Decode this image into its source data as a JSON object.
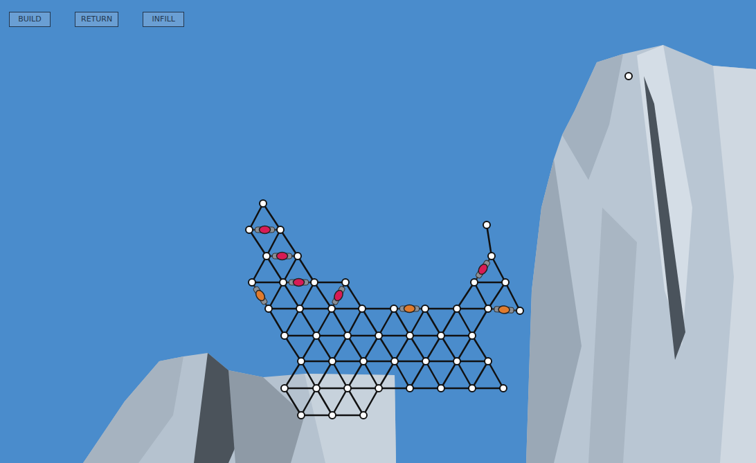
{
  "buttons": [
    {
      "label": "BUILD"
    },
    {
      "label": "RETURN"
    },
    {
      "label": "INFILL"
    }
  ],
  "pistons": [
    {
      "color": "#d81b55"
    },
    {
      "color": "#d81b55"
    },
    {
      "color": "#d81b55"
    },
    {
      "color": "#d81b55"
    },
    {
      "color": "#e07b2e"
    },
    {
      "color": "#e07b2e"
    },
    {
      "color": "#d81b55"
    },
    {
      "color": "#e07b2e"
    }
  ]
}
